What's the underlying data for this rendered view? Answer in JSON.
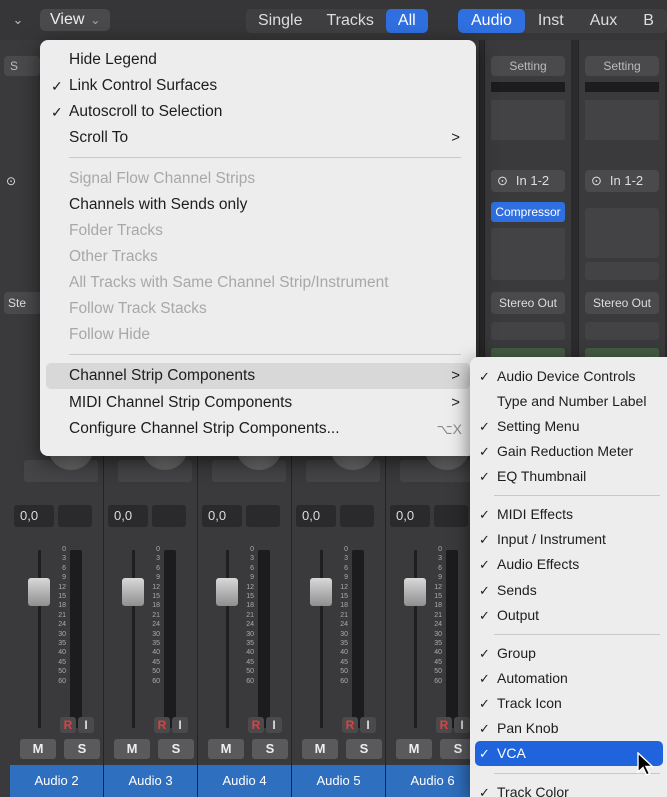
{
  "toolbar": {
    "view_label": "View",
    "seg_single": "Single",
    "seg_tracks": "Tracks",
    "seg_all": "All",
    "seg_audio": "Audio",
    "seg_inst": "Inst",
    "seg_aux": "Aux",
    "seg_b": "B"
  },
  "strips": [
    {
      "name": "Audio 2",
      "gain": "0,0"
    },
    {
      "name": "Audio 3",
      "gain": "0,0"
    },
    {
      "name": "Audio 4",
      "gain": "0,0"
    },
    {
      "name": "Audio 5",
      "gain": "0,0"
    },
    {
      "name": "Audio 6",
      "gain": "0,0"
    }
  ],
  "fader_scale": [
    "0",
    "3",
    "6",
    "9",
    "12",
    "15",
    "18",
    "21",
    "24",
    "30",
    "35",
    "40",
    "45",
    "50",
    "60"
  ],
  "strip_buttons": {
    "r": "R",
    "i": "I",
    "m": "M",
    "s": "S"
  },
  "right_strips": [
    {
      "setting": "Setting",
      "input": "In 1-2",
      "plugin": "Compressor",
      "output": "Stereo Out"
    },
    {
      "setting": "Setting",
      "input": "In 1-2",
      "plugin": "",
      "output": "Stereo Out"
    }
  ],
  "partial_left": {
    "setting_letter": "S",
    "output_prefix": "Ste"
  },
  "view_menu": {
    "hide_legend": "Hide Legend",
    "link_control_surfaces": "Link Control Surfaces",
    "autoscroll": "Autoscroll to Selection",
    "scroll_to": "Scroll To",
    "signal_flow": "Signal Flow Channel Strips",
    "channels_with_sends": "Channels with Sends only",
    "folder_tracks": "Folder Tracks",
    "other_tracks": "Other Tracks",
    "all_tracks_same": "All Tracks with Same Channel Strip/Instrument",
    "follow_track_stacks": "Follow Track Stacks",
    "follow_hide": "Follow Hide",
    "channel_strip_components": "Channel Strip Components",
    "midi_channel_strip_components": "MIDI Channel Strip Components",
    "configure_components": "Configure Channel Strip Components...",
    "configure_shortcut": "⌥X",
    "check": "✓",
    "arrow": ">"
  },
  "submenu": {
    "audio_device_controls": "Audio Device Controls",
    "type_number_label": "Type and Number Label",
    "setting_menu": "Setting Menu",
    "gain_reduction_meter": "Gain Reduction Meter",
    "eq_thumbnail": "EQ Thumbnail",
    "midi_effects": "MIDI Effects",
    "input_instrument": "Input / Instrument",
    "audio_effects": "Audio Effects",
    "sends": "Sends",
    "output": "Output",
    "group": "Group",
    "automation": "Automation",
    "track_icon": "Track Icon",
    "pan_knob": "Pan Knob",
    "vca": "VCA",
    "track_color": "Track Color"
  },
  "colors": {
    "accent": "#2f6fe0",
    "highlight": "#1f64dc",
    "track_name_bg": "#2f6fbf",
    "rec": "#e04040"
  }
}
